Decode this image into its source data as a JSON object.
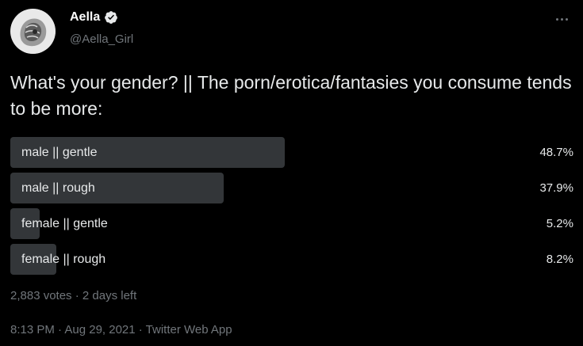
{
  "author": {
    "display_name": "Aella",
    "handle": "@Aella_Girl",
    "verified": true
  },
  "tweet": {
    "text": "What's your gender? || The porn/erotica/fantasies you consume tends to be more:"
  },
  "poll": {
    "options": [
      {
        "label": "male || gentle",
        "percent": 48.7,
        "percent_text": "48.7%"
      },
      {
        "label": "male || rough",
        "percent": 37.9,
        "percent_text": "37.9%"
      },
      {
        "label": "female || gentle",
        "percent": 5.2,
        "percent_text": "5.2%"
      },
      {
        "label": "female || rough",
        "percent": 8.2,
        "percent_text": "8.2%"
      }
    ],
    "footer": "2,883 votes · 2 days left"
  },
  "meta": {
    "timestamp": "8:13 PM · Aug 29, 2021 · Twitter Web App"
  },
  "icons": {
    "verified": "verified-badge-icon",
    "more": "more-options-icon"
  },
  "colors": {
    "background": "#000000",
    "bar": "#333639",
    "text": "#e7e9ea",
    "secondary_text": "#71767b"
  }
}
